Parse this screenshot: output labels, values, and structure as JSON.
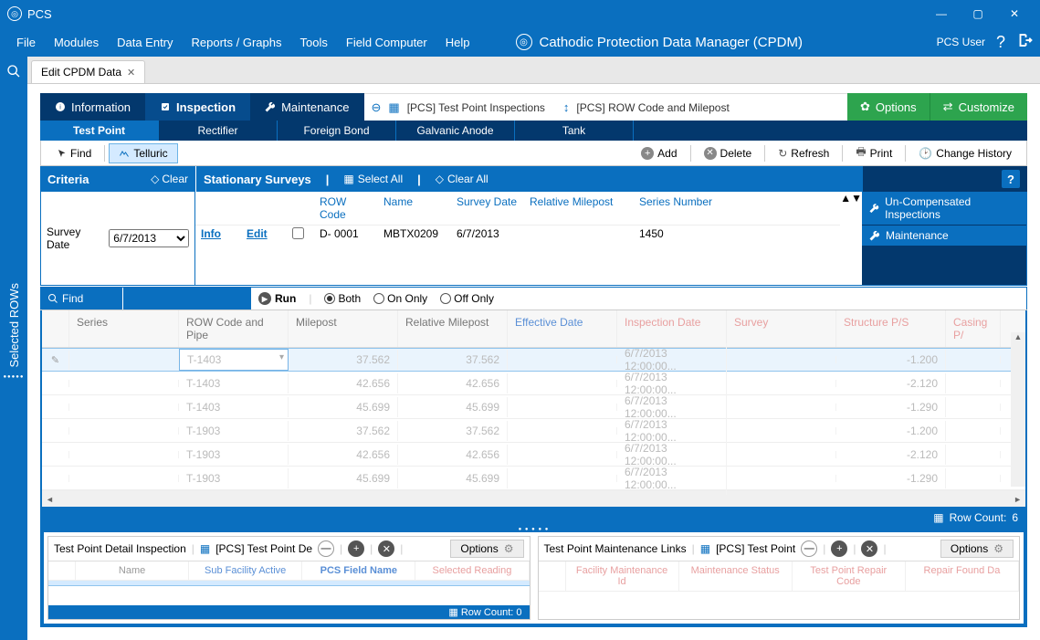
{
  "window": {
    "title": "PCS"
  },
  "menu": {
    "items": [
      "File",
      "Modules",
      "Data Entry",
      "Reports / Graphs",
      "Tools",
      "Field Computer",
      "Help"
    ],
    "brand": "Cathodic Protection Data Manager (CPDM)",
    "user": "PCS User"
  },
  "tab": {
    "label": "Edit CPDM Data"
  },
  "leftrail": {
    "label": "Selected ROWs"
  },
  "ribbon": {
    "info": "Information",
    "insp": "Inspection",
    "maint": "Maintenance",
    "bc1": "[PCS] Test Point Inspections",
    "bc2": "[PCS] ROW Code and Milepost",
    "options": "Options",
    "customize": "Customize"
  },
  "subnav": [
    "Test Point",
    "Rectifier",
    "Foreign Bond",
    "Galvanic Anode",
    "Tank"
  ],
  "toolbar": {
    "find": "Find",
    "telluric": "Telluric",
    "add": "Add",
    "delete": "Delete",
    "refresh": "Refresh",
    "print": "Print",
    "history": "Change History"
  },
  "criteria": {
    "title": "Criteria",
    "clear": "Clear",
    "surveys": "Stationary Surveys",
    "selectall": "Select All",
    "clearall": "Clear All",
    "help": "?",
    "survey_date_label": "Survey Date",
    "survey_date": "6/7/2013"
  },
  "survey_headers": {
    "row": "ROW Code",
    "name": "Name",
    "date": "Survey Date",
    "rm": "Relative Milepost",
    "ser": "Series Number"
  },
  "survey_row": {
    "info": "Info",
    "edit": "Edit",
    "row": "D- 0001",
    "name": "MBTX0209",
    "date": "6/7/2013",
    "rm": "",
    "ser": "1450"
  },
  "rside": {
    "uncomp": "Un-Compensated Inspections",
    "maint": "Maintenance"
  },
  "run": {
    "find": "Find",
    "run": "Run",
    "both": "Both",
    "on": "On Only",
    "off": "Off Only"
  },
  "grid": {
    "headers": {
      "series": "Series",
      "row": "ROW Code and Pipe",
      "mp": "Milepost",
      "rmp": "Relative Milepost",
      "eff": "Effective Date",
      "insp": "Inspection Date",
      "surv": "Survey",
      "sps": "Structure P/S",
      "cps": "Casing P/"
    },
    "rows": [
      {
        "series": "T-1403",
        "mp": "37.562",
        "rmp": "37.562",
        "insp": "6/7/2013 12:00:00...",
        "sps": "-1.200"
      },
      {
        "series": "T-1403",
        "mp": "42.656",
        "rmp": "42.656",
        "insp": "6/7/2013 12:00:00...",
        "sps": "-2.120"
      },
      {
        "series": "T-1403",
        "mp": "45.699",
        "rmp": "45.699",
        "insp": "6/7/2013 12:00:00...",
        "sps": "-1.290"
      },
      {
        "series": "T-1903",
        "mp": "37.562",
        "rmp": "37.562",
        "insp": "6/7/2013 12:00:00...",
        "sps": "-1.200"
      },
      {
        "series": "T-1903",
        "mp": "42.656",
        "rmp": "42.656",
        "insp": "6/7/2013 12:00:00...",
        "sps": "-2.120"
      },
      {
        "series": "T-1903",
        "mp": "45.699",
        "rmp": "45.699",
        "insp": "6/7/2013 12:00:00...",
        "sps": "-1.290"
      }
    ],
    "rowcount_label": "Row Count:",
    "rowcount": "6"
  },
  "bot1": {
    "title": "Test Point Detail Inspection",
    "sub": "[PCS] Test Point De",
    "options": "Options",
    "headers": {
      "name": "Name",
      "subfac": "Sub Facility Active",
      "pcs": "PCS Field Name",
      "sel": "Selected Reading"
    },
    "rowcount": "Row Count:  0"
  },
  "bot2": {
    "title": "Test Point Maintenance Links",
    "sub": "[PCS] Test Point",
    "options": "Options",
    "headers": {
      "fmid": "Facility Maintenance Id",
      "mstat": "Maintenance Status",
      "tprc": "Test Point Repair Code",
      "rfd": "Repair Found Da"
    }
  }
}
